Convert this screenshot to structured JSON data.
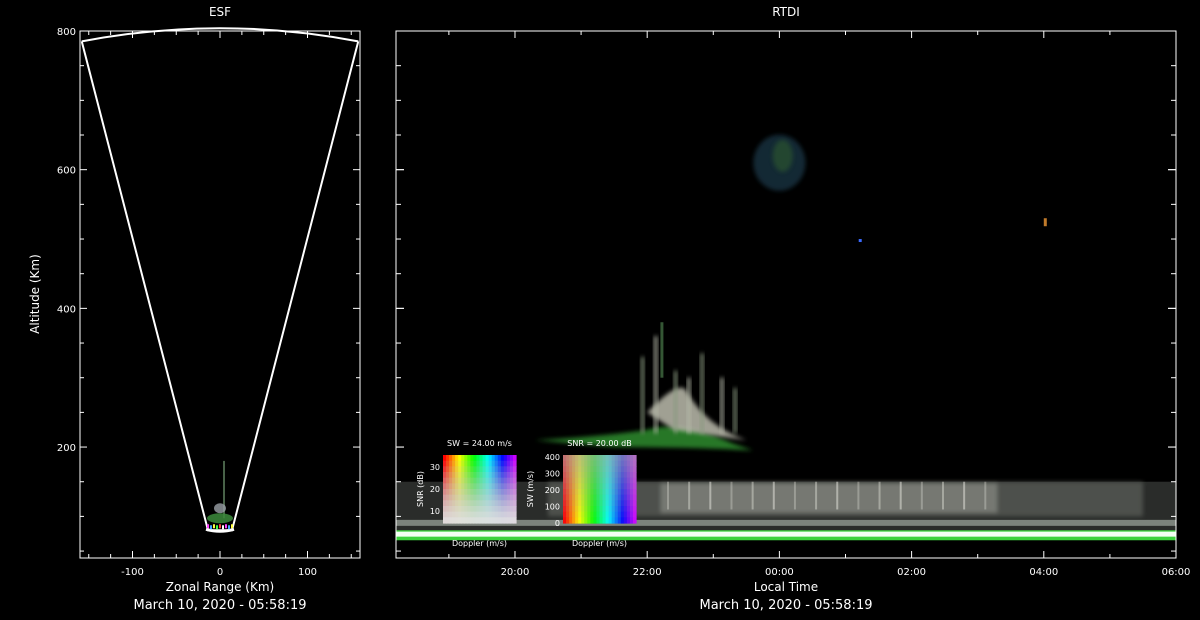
{
  "colors": {
    "background": "#000000",
    "axes": "#ffffff",
    "fan_outline": "#ffffff",
    "echo_green": "#3cd23c"
  },
  "chart_data": [
    {
      "type": "fan-scatter",
      "title": "ESF",
      "xlabel": "Zonal Range (Km)",
      "ylabel": "Altitude (Km)",
      "xlim": [
        -160,
        160
      ],
      "ylim": [
        40,
        800
      ],
      "xticks": [
        -100,
        0,
        100
      ],
      "yticks": [
        200,
        400,
        600,
        800
      ],
      "fan": {
        "max_range_km": 800,
        "left_edge": [
          -158,
          785
        ],
        "right_edge": [
          158,
          785
        ],
        "apex_alt_km": 80
      },
      "echo": {
        "x_center_km": 0,
        "alt_bottom_km": 80,
        "alt_top_km": 180
      },
      "date": "March 10, 2020 - 05:58:19"
    },
    {
      "type": "heatmap",
      "title": "RTDI",
      "xlabel": "Local Time",
      "xticks": [
        "20:00",
        "22:00",
        "00:00",
        "02:00",
        "04:00",
        "06:00"
      ],
      "xlim_hours": [
        18.2,
        30.0
      ],
      "ylim": [
        40,
        800
      ],
      "features": [
        {
          "name": "plume",
          "t_start": 20.3,
          "t_end": 23.7,
          "alt_bottom": 200,
          "alt_top": 380
        },
        {
          "name": "patch",
          "t_start": 23.5,
          "t_end": 24.5,
          "alt_bottom": 540,
          "alt_top": 680
        },
        {
          "name": "bottomside layer",
          "t_start": 18.2,
          "t_end": 30.0,
          "alt_bottom": 75,
          "alt_top": 150
        }
      ],
      "date": "March 10, 2020 - 05:58:19"
    }
  ],
  "legends": {
    "sw_title": "SW = 24.00 m/s",
    "sw_ylabel": "SNR (dB)",
    "sw_yticks": [
      "30",
      "20",
      "10"
    ],
    "sw_xlabel": "Doppler (m/s)",
    "snr_title": "SNR = 20.00 dB",
    "snr_ylabel": "SW (m/s)",
    "snr_yticks": [
      "400",
      "300",
      "200",
      "100",
      "0"
    ],
    "snr_xlabel": "Doppler (m/s)"
  }
}
